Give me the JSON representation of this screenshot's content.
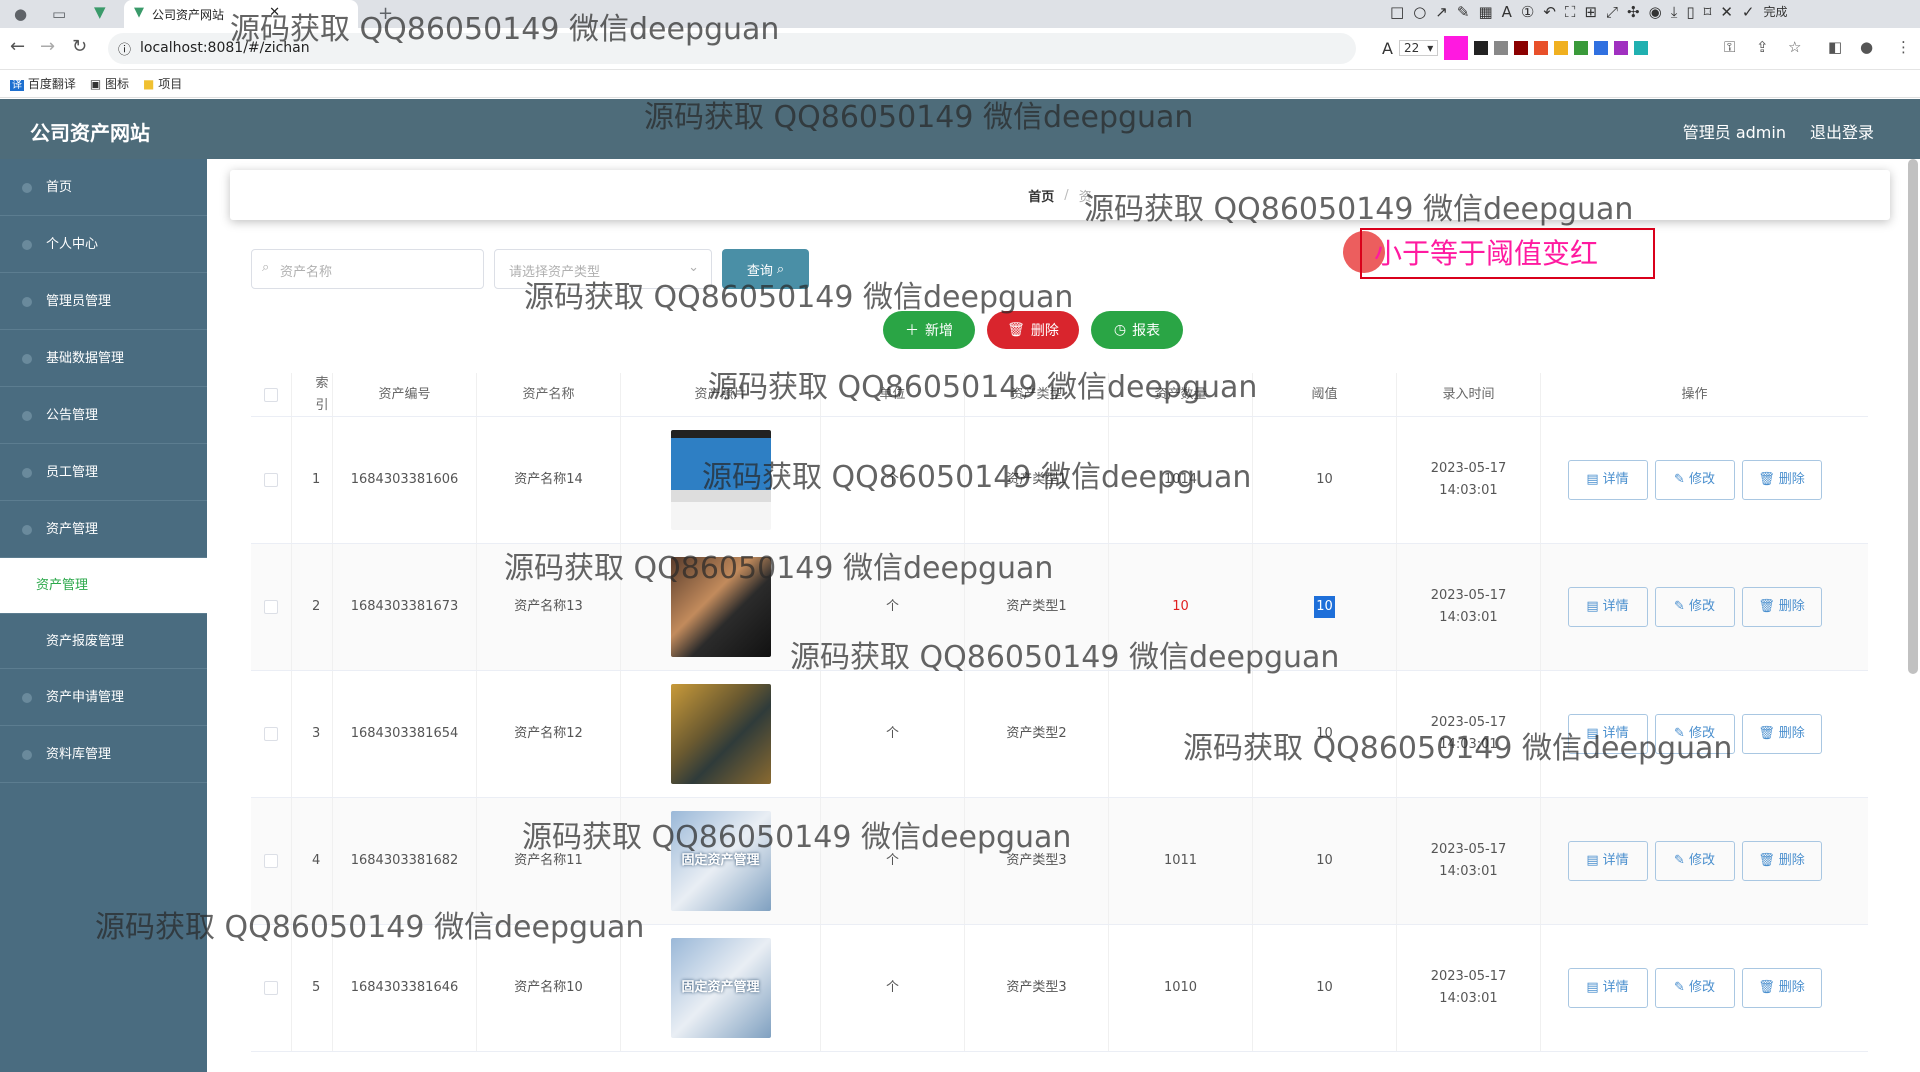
{
  "browser": {
    "tab_title": "公司资产网站",
    "url": "localhost:8081/#/zichan",
    "bookmarks": [
      "百度翻译",
      "图标",
      "项目"
    ],
    "font_size_value": "22",
    "done_label": "完成"
  },
  "header": {
    "logo": "公司资产网站",
    "user": "管理员 admin",
    "logout": "退出登录"
  },
  "sidebar": {
    "items": [
      {
        "label": "首页"
      },
      {
        "label": "个人中心"
      },
      {
        "label": "管理员管理"
      },
      {
        "label": "基础数据管理"
      },
      {
        "label": "公告管理"
      },
      {
        "label": "员工管理"
      },
      {
        "label": "资产管理"
      },
      {
        "label": "资产管理"
      },
      {
        "label": "资产报废管理"
      },
      {
        "label": "资产申请管理"
      },
      {
        "label": "资料库管理"
      }
    ]
  },
  "breadcrumb": {
    "home": "首页",
    "sep": "/",
    "current": "资"
  },
  "search": {
    "name_placeholder": "资产名称",
    "type_placeholder": "请选择资产类型",
    "query_label": "查询"
  },
  "annotation": {
    "text": "小于等于阈值变红"
  },
  "actions": {
    "add": "新增",
    "delete": "删除",
    "report": "报表"
  },
  "table": {
    "headers": [
      "索引",
      "资产编号",
      "资产名称",
      "资产照片",
      "单位",
      "资产类型",
      "资产数量",
      "阈值",
      "录入时间",
      "操作"
    ],
    "rows": [
      {
        "index": "1",
        "code": "1684303381606",
        "name": "资产名称14",
        "unit": "个",
        "type": "资产类型1",
        "qty": "1014",
        "threshold": "10",
        "time": "2023-05-17 14:03:01"
      },
      {
        "index": "2",
        "code": "1684303381673",
        "name": "资产名称13",
        "unit": "个",
        "type": "资产类型1",
        "qty": "10",
        "threshold": "10",
        "time": "2023-05-17 14:03:01"
      },
      {
        "index": "3",
        "code": "1684303381654",
        "name": "资产名称12",
        "unit": "个",
        "type": "资产类型2",
        "qty": "",
        "threshold": "10",
        "time": "2023-05-17 14:03:01"
      },
      {
        "index": "4",
        "code": "1684303381682",
        "name": "资产名称11",
        "unit": "个",
        "type": "资产类型3",
        "qty": "1011",
        "threshold": "10",
        "time": "2023-05-17 14:03:01"
      },
      {
        "index": "5",
        "code": "1684303381646",
        "name": "资产名称10",
        "unit": "个",
        "type": "资产类型3",
        "qty": "1010",
        "threshold": "10",
        "time": "2023-05-17 14:03:01"
      }
    ],
    "row_actions": {
      "detail": "详情",
      "edit": "修改",
      "delete": "删除"
    },
    "photo_overlay_text": "固定资产管理"
  },
  "watermark": "源码获取 QQ86050149 微信deepguan",
  "colors": {
    "topbar": "#4e6c7a",
    "sidebar": "#4a6c80",
    "green": "#2aa545",
    "red": "#d9252d",
    "warn": "#e02020"
  }
}
